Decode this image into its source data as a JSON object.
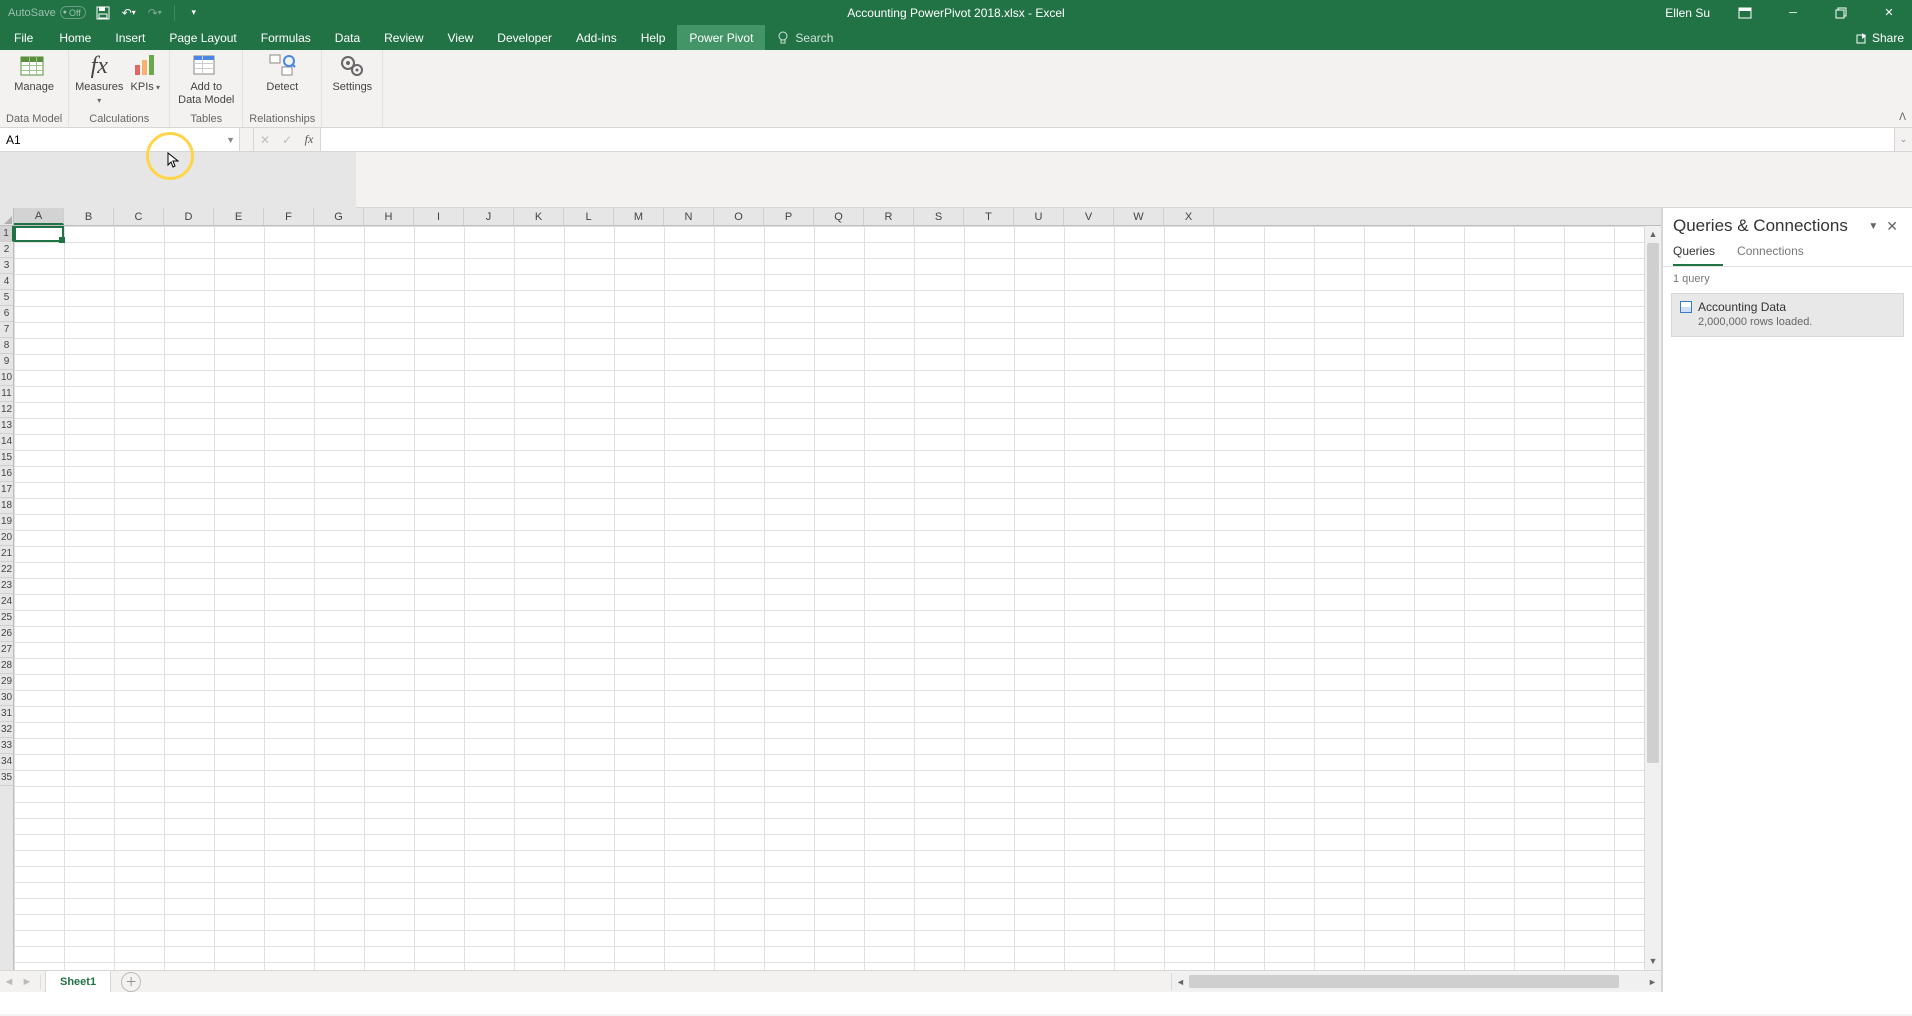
{
  "titlebar": {
    "autosave_label": "AutoSave",
    "autosave_state": "Off",
    "doc_title": "Accounting PowerPivot 2018.xlsx  -  Excel",
    "user_name": "Ellen Su"
  },
  "tabs": {
    "file": "File",
    "items": [
      "Home",
      "Insert",
      "Page Layout",
      "Formulas",
      "Data",
      "Review",
      "View",
      "Developer",
      "Add-ins",
      "Help",
      "Power Pivot"
    ],
    "active": "Power Pivot",
    "tellme_placeholder": "Search",
    "share": "Share"
  },
  "ribbon": {
    "groups": [
      {
        "name": "Data Model",
        "buttons": [
          {
            "id": "manage",
            "label": "Manage"
          }
        ]
      },
      {
        "name": "Calculations",
        "buttons": [
          {
            "id": "measures",
            "label": "Measures",
            "drop": true
          },
          {
            "id": "kpis",
            "label": "KPIs",
            "drop": true
          }
        ]
      },
      {
        "name": "Tables",
        "buttons": [
          {
            "id": "add-to-dm",
            "label": "Add to\nData Model"
          }
        ]
      },
      {
        "name": "Relationships",
        "buttons": [
          {
            "id": "detect",
            "label": "Detect"
          }
        ]
      },
      {
        "name": "",
        "buttons": [
          {
            "id": "settings",
            "label": "Settings"
          }
        ]
      }
    ]
  },
  "formula_bar": {
    "namebox_value": "A1",
    "formula_value": ""
  },
  "grid": {
    "columns": [
      "A",
      "B",
      "C",
      "D",
      "E",
      "F",
      "G",
      "H",
      "I",
      "J",
      "K",
      "L",
      "M",
      "N",
      "O",
      "P",
      "Q",
      "R",
      "S",
      "T",
      "U",
      "V",
      "W",
      "X"
    ],
    "rows": 35,
    "active_cell": "A1"
  },
  "pane": {
    "title": "Queries & Connections",
    "tabs": [
      "Queries",
      "Connections"
    ],
    "active_tab": "Queries",
    "count_label": "1 query",
    "query": {
      "name": "Accounting Data",
      "status": "2,000,000 rows loaded."
    }
  },
  "sheet_tabs": {
    "active": "Sheet1"
  }
}
